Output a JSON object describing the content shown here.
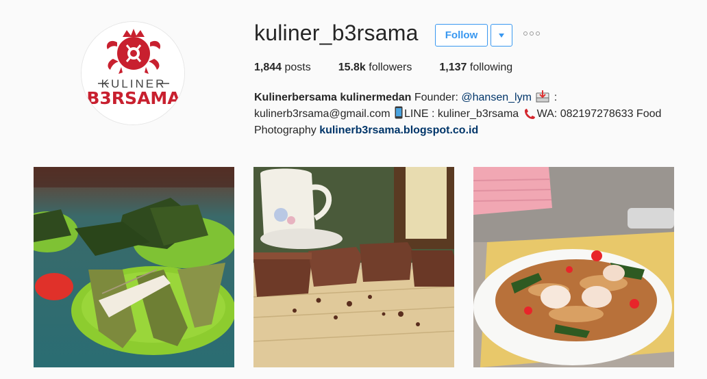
{
  "profile": {
    "username": "kuliner_b3rsama",
    "avatar_text_top": "KULINER",
    "avatar_text_bottom": "B3RSAMA",
    "follow_label": "Follow",
    "stats": {
      "posts_count": "1,844",
      "posts_label": "posts",
      "followers_count": "15.8k",
      "followers_label": "followers",
      "following_count": "1,137",
      "following_label": "following"
    },
    "bio": {
      "name": "Kulinerbersama kulinermedan",
      "founder_label": "Founder:",
      "mention": "@hansen_lym",
      "colon": ":",
      "email": "kulinerb3rsama@gmail.com",
      "line": "LINE : kuliner_b3rsama",
      "wa": "WA: 082197278633 Food",
      "photography": "Photography",
      "website": "kulinerb3rsama.blogspot.co.id"
    }
  },
  "icons": {
    "caret": "chevron-down-icon",
    "more": "ellipsis-icon",
    "inbox": "inbox-tray-icon",
    "phone_mobile": "mobile-phone-icon",
    "telephone": "telephone-receiver-icon"
  },
  "colors": {
    "accent": "#3897f0",
    "link": "#003569",
    "background": "#fafafa",
    "logo_red": "#c8202f"
  },
  "posts": [
    {
      "subject": "banana leaf wrapped snacks"
    },
    {
      "subject": "brownies"
    },
    {
      "subject": "fried noodles with shrimp"
    }
  ]
}
